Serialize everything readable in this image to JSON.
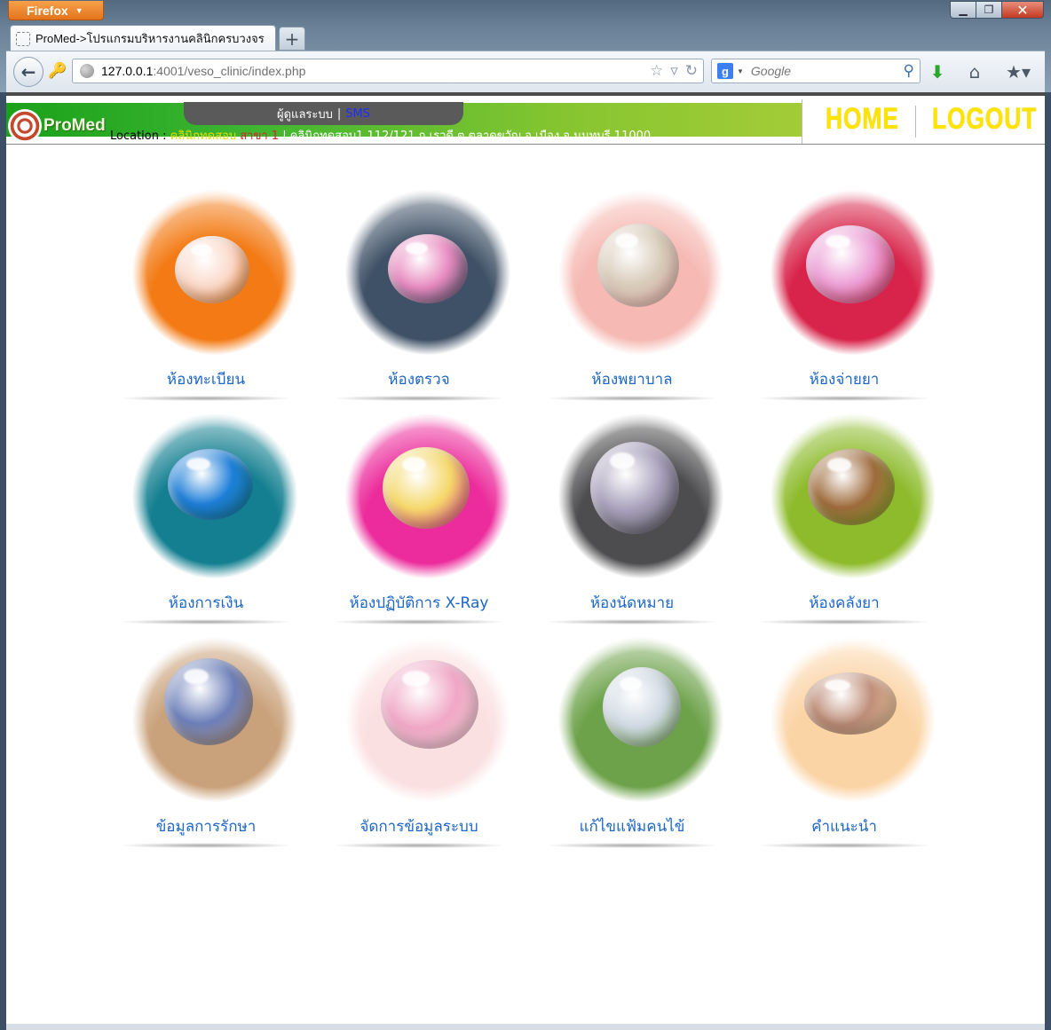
{
  "browser": {
    "menu_label": "Firefox",
    "tab_title": "ProMed->โปรแกรมบริหารงานคลินิกครบวงจร",
    "new_tab_symbol": "+",
    "url_host": "127.0.0.1",
    "url_rest": ":4001/veso_clinic/index.php",
    "search_placeholder": "Google",
    "search_engine_letter": "g"
  },
  "header": {
    "admin_label": "ผู้ดูแลระบบ",
    "separator": "|",
    "sms_label": "SMS",
    "logo_text": "ProMed",
    "location_label": "Location :",
    "clinic_name": "คลินิกทดสอบ",
    "branch": "สาขา 1",
    "address": "| คลินิกทดสอบ1 112/121 ถ.เรวดี ต.ตลาดขวัญ อ.เมือง จ.นนทบุรี 11000",
    "home_label": "HOME",
    "logout_label": "LOGOUT",
    "colors": {
      "bar_start": "#1aa11a",
      "bar_end": "#a3cc37",
      "nav_yellow": "#ffe400",
      "label_blue": "#1c66c8"
    }
  },
  "menu": {
    "items": [
      {
        "label": "ห้องทะเบียน",
        "bg": "#f37a14",
        "drop": "#fbd8c8"
      },
      {
        "label": "ห้องตรวจ",
        "bg": "#3f5166",
        "drop": "#e88bc0"
      },
      {
        "label": "ห้องพยาบาล",
        "bg": "#f6b9b3",
        "drop": "#d8cbb9"
      },
      {
        "label": "ห้องจ่ายยา",
        "bg": "#d8244a",
        "drop": "#ec9fd6"
      },
      {
        "label": "ห้องการเงิน",
        "bg": "#137f90",
        "drop": "#1e7fd8"
      },
      {
        "label": "ห้องปฏิบัติการ X-Ray",
        "bg": "#ec2c9c",
        "drop": "#f5d86a"
      },
      {
        "label": "ห้องนัดหมาย",
        "bg": "#4d4c4e",
        "drop": "#a8a0bb"
      },
      {
        "label": "ห้องคลังยา",
        "bg": "#8dbb2c",
        "drop": "#9e6b3c"
      },
      {
        "label": "ข้อมูลการรักษา",
        "bg": "#c9a17a",
        "drop": "#6c7fb8"
      },
      {
        "label": "จัดการข้อมูลระบบ",
        "bg": "#fbe0e1",
        "drop": "#f0a7c5"
      },
      {
        "label": "แก้ไขแฟ้มคนไข้",
        "bg": "#6da24a",
        "drop": "#cfd9e3"
      },
      {
        "label": "คำแนะนำ",
        "bg": "#fbd4a6",
        "drop": "#bf8f7a"
      }
    ]
  }
}
